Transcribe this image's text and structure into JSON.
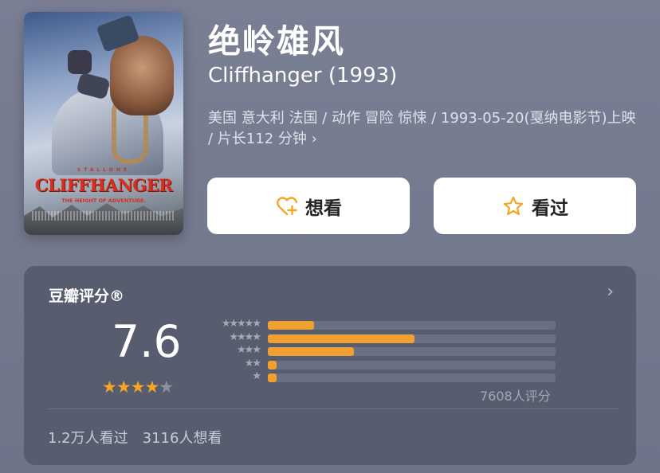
{
  "movie": {
    "title_cn": "绝岭雄风",
    "title_en": "Cliffhanger (1993)",
    "meta": "美国 意大利 法国 / 动作 冒险 惊悚 / 1993-05-20(戛纳电影节)上映 / 片长112 分钟",
    "meta_chevron": "›",
    "poster": {
      "title_text": "CLIFFHANGER",
      "tagline": "THE HEIGHT OF ADVENTURE.",
      "top_small": "STALLONE"
    }
  },
  "buttons": {
    "want": {
      "label": "想看",
      "icon": "heart-plus-icon",
      "icon_color": "#f5a623"
    },
    "seen": {
      "label": "看过",
      "icon": "star-outline-icon",
      "icon_color": "#f5a623"
    }
  },
  "rating": {
    "title": "豆瓣评分®",
    "chevron": "›",
    "score": "7.6",
    "stars_filled": 4,
    "stars_total": 5,
    "distribution": [
      {
        "stars": "★★★★★",
        "fraction": 0.16
      },
      {
        "stars": "★★★★",
        "fraction": 0.51
      },
      {
        "stars": "★★★",
        "fraction": 0.3
      },
      {
        "stars": "★★",
        "fraction": 0.03
      },
      {
        "stars": "★",
        "fraction": 0.03
      }
    ],
    "count_label": "7608人评分",
    "bar_color": "#f0a030"
  },
  "footer": {
    "watched": "1.2万人看过",
    "want_to_watch": "3116人想看"
  }
}
